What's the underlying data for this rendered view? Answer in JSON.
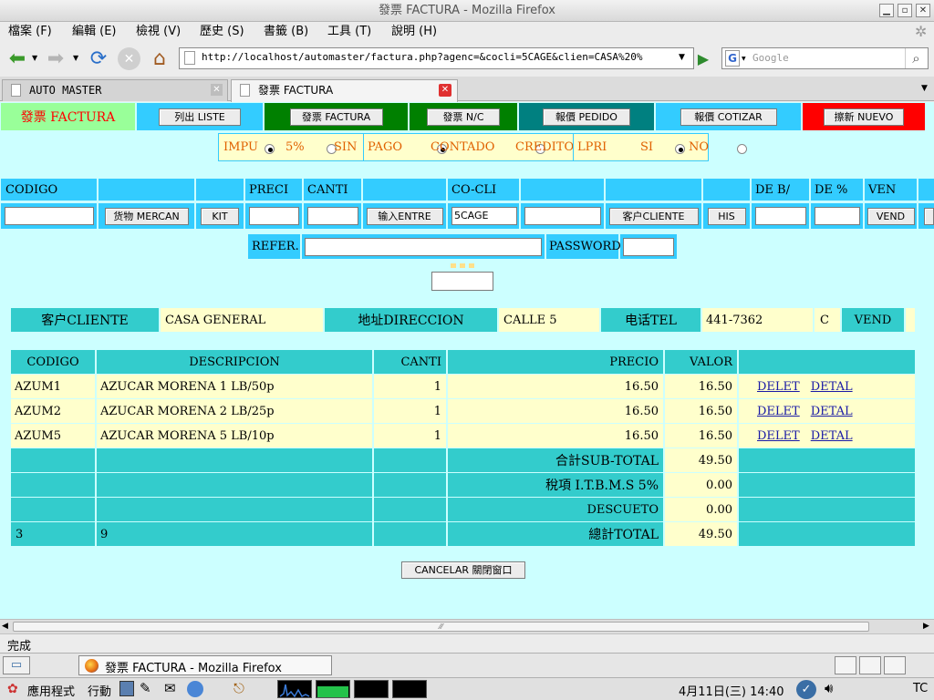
{
  "window": {
    "title": "發票 FACTURA - Mozilla Firefox"
  },
  "menu": [
    "檔案 (F)",
    "編輯 (E)",
    "檢視 (V)",
    "歷史 (S)",
    "書籤 (B)",
    "工具 (T)",
    "說明 (H)"
  ],
  "nav": {
    "url": "http://localhost/automaster/factura.php?agenc=&cocli=5CAGE&clien=CASA%20%",
    "search_placeholder": "Google"
  },
  "tabs": [
    {
      "label": "AUTO MASTER"
    },
    {
      "label": "發票 FACTURA"
    }
  ],
  "page": {
    "title": "發票 FACTURA",
    "buttons": {
      "liste": "列出 LISTE",
      "factura": "發票 FACTURA",
      "nc": "發票 N/C",
      "pedido": "報價 PEDIDO",
      "cotizar": "報價 COTIZAR",
      "nuevo": "擦新 NUEVO"
    },
    "colors": {
      "title_cell": "#99ff99",
      "blue": "#33ccff",
      "green": "#008000",
      "teal": "#008080",
      "red": "#ff0000",
      "background": "#ccffff",
      "table_header": "#33cccc",
      "table_cell": "#ffffcc"
    },
    "options": {
      "impu_label": "IMPU",
      "impu_a": "5%",
      "impu_b": "SIN",
      "impu_selected": "5%",
      "pago_label": "PAGO",
      "pago_a": "CONTADO",
      "pago_b": "CREDITO",
      "pago_selected": "CONTADO",
      "lpri_label": "LPRI",
      "lpri_a": "SI",
      "lpri_b": "NO",
      "lpri_selected": "SI"
    },
    "entry": {
      "headers": {
        "codigo": "CODIGO",
        "preci": "PRECI",
        "canti": "CANTI",
        "cocli": "CO-CLI",
        "deb": "DE B/",
        "dep": "DE %",
        "ven": "VEN"
      },
      "buttons": {
        "mercan": "货物 MERCAN",
        "kit": "KIT",
        "entre": "输入ENTRE",
        "cliente": "客户CLIENTE",
        "his": "HIS",
        "vend": "VEND"
      },
      "cocli_value": "5CAGE",
      "refer_label": "REFER.",
      "password_label": "PASSWORD:"
    },
    "client": {
      "cliente_label": "客户CLIENTE",
      "cliente_value": "CASA GENERAL",
      "direccion_label": "地址DIRECCION",
      "direccion_value": "CALLE 5",
      "tel_label": "电话TEL",
      "tel_value": "441-7362",
      "type_value": "C",
      "vend_value": "VEND"
    },
    "table": {
      "headers": {
        "codigo": "CODIGO",
        "descripcion": "DESCRIPCION",
        "canti": "CANTI",
        "precio": "PRECIO",
        "valor": "VALOR"
      },
      "rows": [
        {
          "codigo": "AZUM1",
          "descripcion": "AZUCAR MORENA 1 LB/50p",
          "canti": "1",
          "precio": "16.50",
          "valor": "16.50",
          "delet": "DELET",
          "detal": "DETAL"
        },
        {
          "codigo": "AZUM2",
          "descripcion": "AZUCAR MORENA 2 LB/25p",
          "canti": "1",
          "precio": "16.50",
          "valor": "16.50",
          "delet": "DELET",
          "detal": "DETAL"
        },
        {
          "codigo": "AZUM5",
          "descripcion": "AZUCAR MORENA 5 LB/10p",
          "canti": "1",
          "precio": "16.50",
          "valor": "16.50",
          "delet": "DELET",
          "detal": "DETAL"
        }
      ],
      "totals": {
        "subtotal_label": "合計SUB-TOTAL",
        "subtotal_value": "49.50",
        "tax_label": "稅項 I.T.B.M.S 5%",
        "tax_value": "0.00",
        "descuento_label": "DESCUETO",
        "descuento_value": "0.00",
        "total_label": "總計TOTAL",
        "total_value": "49.50",
        "count_items": "3",
        "count_qty": "9"
      }
    },
    "cancel_button": "CANCELAR 關閉窗口"
  },
  "status": {
    "text": "完成"
  },
  "taskbar": {
    "window_label": "發票 FACTURA - Mozilla Firefox"
  },
  "panel": {
    "apps": "應用程式",
    "actions": "行動",
    "clock": "4月11日(三) 14:40",
    "locale": "TC"
  }
}
